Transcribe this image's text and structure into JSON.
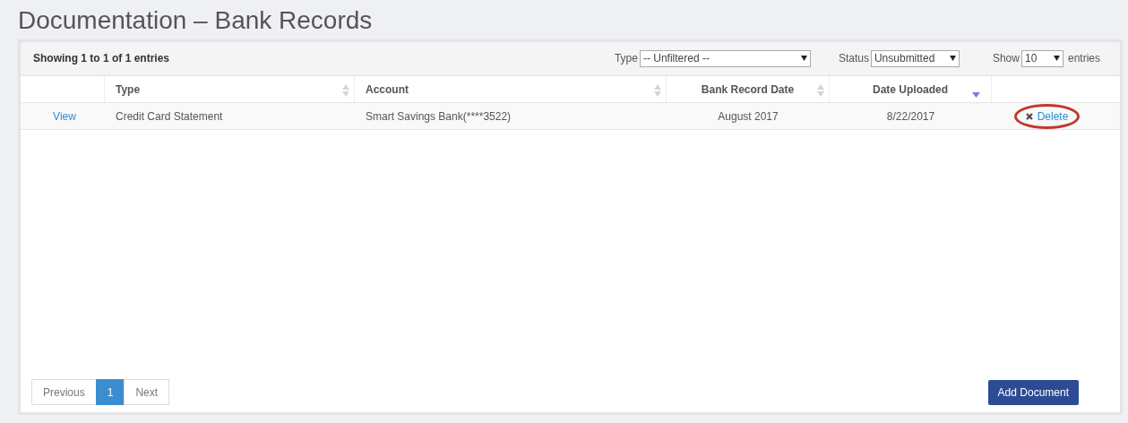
{
  "title": "Documentation – Bank Records",
  "info": "Showing 1 to 1 of 1 entries",
  "filters": [
    {
      "label": "Type",
      "value": "-- Unfiltered --",
      "kind": "wide"
    },
    {
      "label": "Status",
      "value": "Unsubmitted",
      "kind": "medium"
    },
    {
      "label": "Show",
      "value": "10",
      "kind": "narrow",
      "suffix": "entries"
    }
  ],
  "table": {
    "columns": [
      {
        "label": "Type",
        "sorted": false
      },
      {
        "label": "Account",
        "sorted": false
      },
      {
        "label": "Bank Record Date",
        "sorted": false
      },
      {
        "label": "Date Uploaded",
        "sorted": true
      }
    ],
    "rows": [
      {
        "view": "View",
        "type": "Credit Card Statement",
        "account": "Smart Savings Bank(****3522)",
        "bank_record_date": "August 2017",
        "date_uploaded": "8/22/2017",
        "delete": "Delete",
        "delete_highlighted": true
      }
    ]
  },
  "pagination": [
    {
      "label": "Previous",
      "selected": false
    },
    {
      "label": "1",
      "selected": true
    },
    {
      "label": "Next",
      "selected": false
    }
  ],
  "add_button": "Add Document"
}
